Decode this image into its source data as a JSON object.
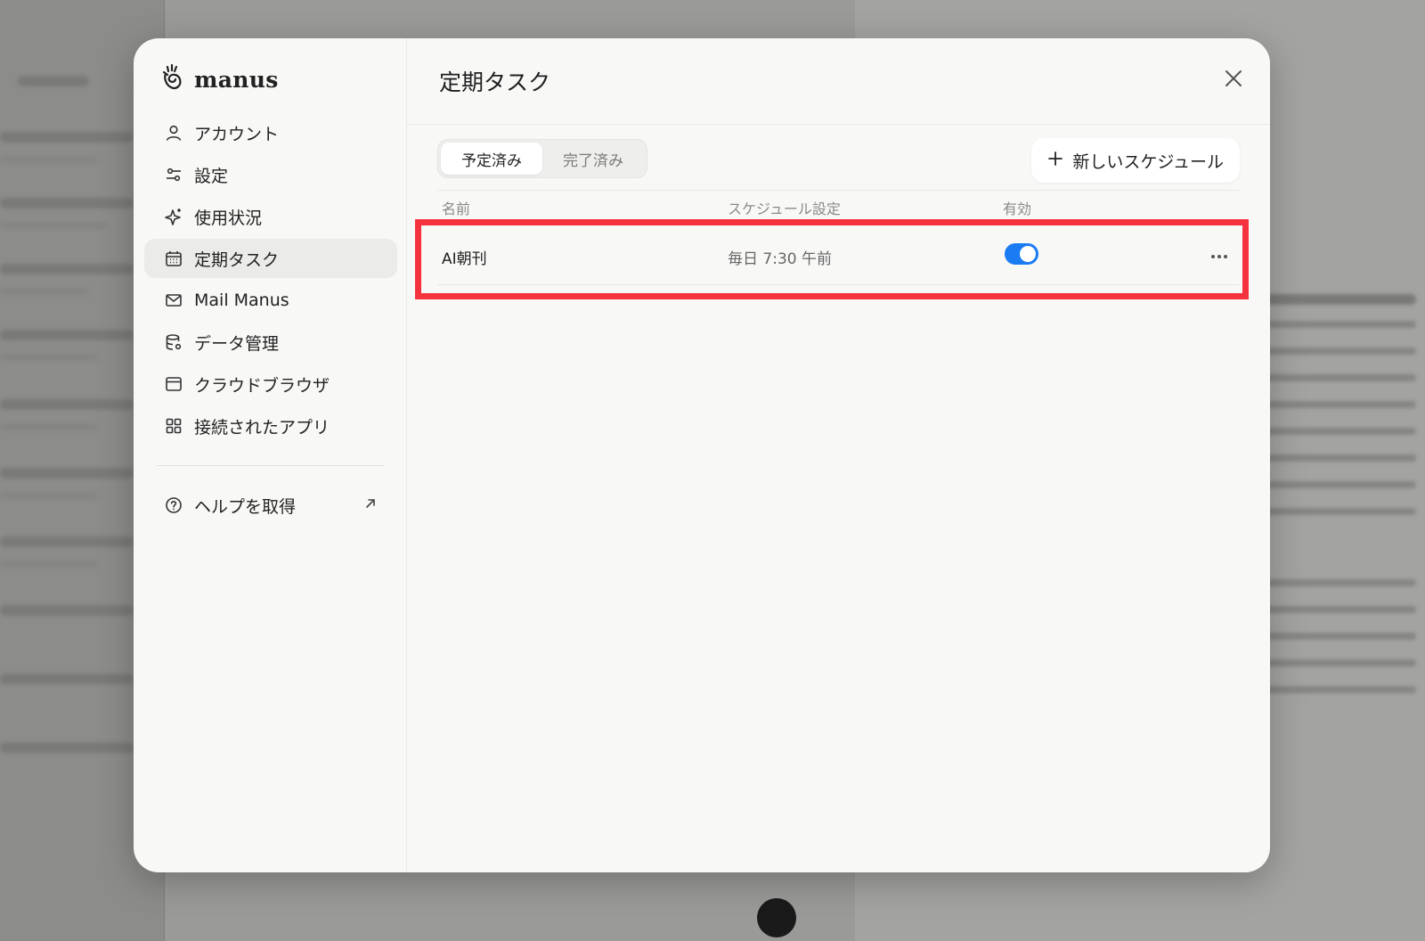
{
  "brand": {
    "name": "manus"
  },
  "sidebar": {
    "items": [
      {
        "label": "アカウント",
        "icon": "user-icon"
      },
      {
        "label": "設定",
        "icon": "sliders-icon"
      },
      {
        "label": "使用状況",
        "icon": "sparkle-icon"
      },
      {
        "label": "定期タスク",
        "icon": "calendar-icon",
        "active": true
      },
      {
        "label": "Mail Manus",
        "icon": "mail-icon"
      },
      {
        "label": "データ管理",
        "icon": "database-icon"
      },
      {
        "label": "クラウドブラウザ",
        "icon": "browser-icon"
      },
      {
        "label": "接続されたアプリ",
        "icon": "grid-icon"
      }
    ],
    "help": {
      "label": "ヘルプを取得",
      "icon": "help-icon",
      "ext_icon": "external-link-icon"
    }
  },
  "main": {
    "title": "定期タスク",
    "tabs": [
      {
        "label": "予定済み",
        "active": true
      },
      {
        "label": "完了済み",
        "active": false
      }
    ],
    "new_button": "新しいスケジュール",
    "columns": {
      "name": "名前",
      "schedule": "スケジュール設定",
      "enabled": "有効"
    },
    "rows": [
      {
        "name": "AI朝刊",
        "schedule": "毎日 7:30 午前",
        "enabled": true
      }
    ]
  },
  "colors": {
    "accent": "#1a7bf2",
    "highlight": "#f5333f"
  }
}
